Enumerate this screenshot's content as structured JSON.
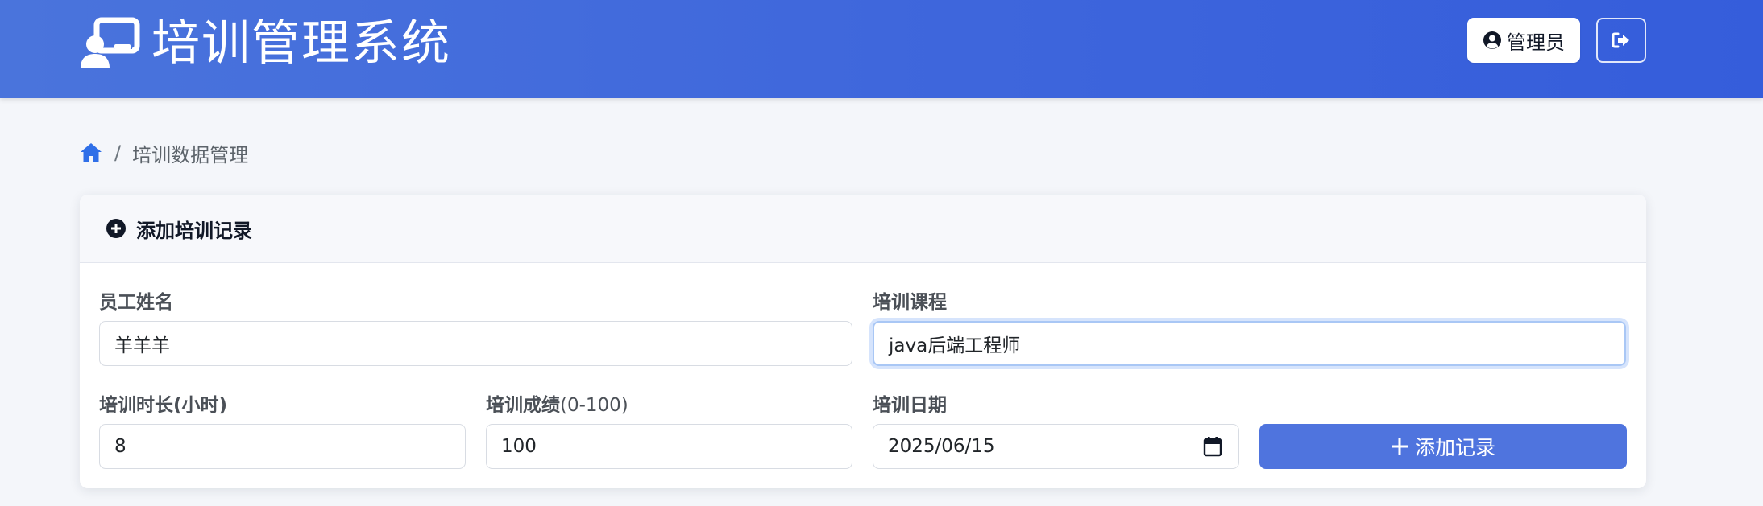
{
  "header": {
    "app_title": "培训管理系统",
    "user_label": "管理员"
  },
  "breadcrumb": {
    "current": "培训数据管理",
    "separator": "/"
  },
  "form": {
    "title": "添加培训记录",
    "employee_name": {
      "label": "员工姓名",
      "value": "羊羊羊"
    },
    "course": {
      "label": "培训课程",
      "value": "java后端工程师"
    },
    "duration": {
      "label": "培训时长(小时)",
      "value": "8"
    },
    "score": {
      "label_main": "培训成绩",
      "label_range": "(0-100)",
      "value": "100"
    },
    "date": {
      "label": "培训日期",
      "value": "2025/06/15"
    },
    "submit_label": "添加记录"
  },
  "icons": {
    "brand": "chalkboard-teacher-icon",
    "user": "user-circle-icon",
    "logout": "sign-out-icon",
    "home": "home-icon",
    "add": "plus-circle-icon",
    "calendar": "calendar-icon",
    "plus": "plus-icon"
  },
  "colors": {
    "header_bg": "#3f67dc",
    "primary_button": "#4f74de",
    "home_icon": "#2f6fe8",
    "focus_ring": "#a9c7f5"
  }
}
